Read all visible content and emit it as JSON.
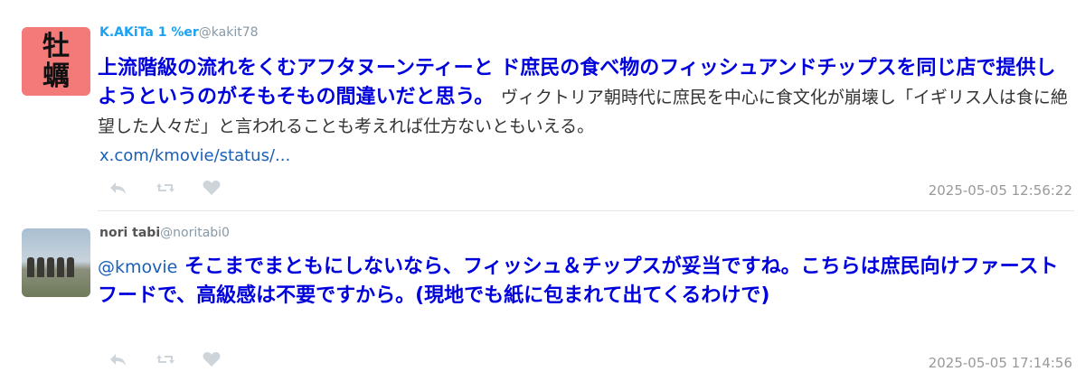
{
  "tweets": [
    {
      "display_name": "K.AKiTa 1 %er",
      "handle": "@kakit78",
      "avatar_text": [
        "牡",
        "蠣"
      ],
      "bold_text": "上流階級の流れをくむアフタヌーンティーと ド庶民の食べ物のフィッシュアンドチップスを同じ店で提供しようというのがそもそもの間違いだと思う。",
      "plain_text": "ヴィクトリア朝時代に庶民を中心に食文化が崩壊し「イギリス人は食に絶望した人々だ」と言われることも考えれば仕方ないともいえる。",
      "link": "x.com/kmovie/status/...",
      "timestamp": "2025-05-05 12:56:22"
    },
    {
      "display_name": "nori tabi",
      "handle": "@noritabi0",
      "mention": "@kmovie",
      "bold_text": "そこまでまともにしないなら、フィッシュ＆チップスが妥当ですね。こちらは庶民向けファーストフードで、高級感は不要ですから。(現地でも紙に包まれて出てくるわけで)",
      "timestamp": "2025-05-05 17:14:56"
    }
  ],
  "icons": [
    "reply-icon",
    "retweet-icon",
    "like-icon"
  ]
}
